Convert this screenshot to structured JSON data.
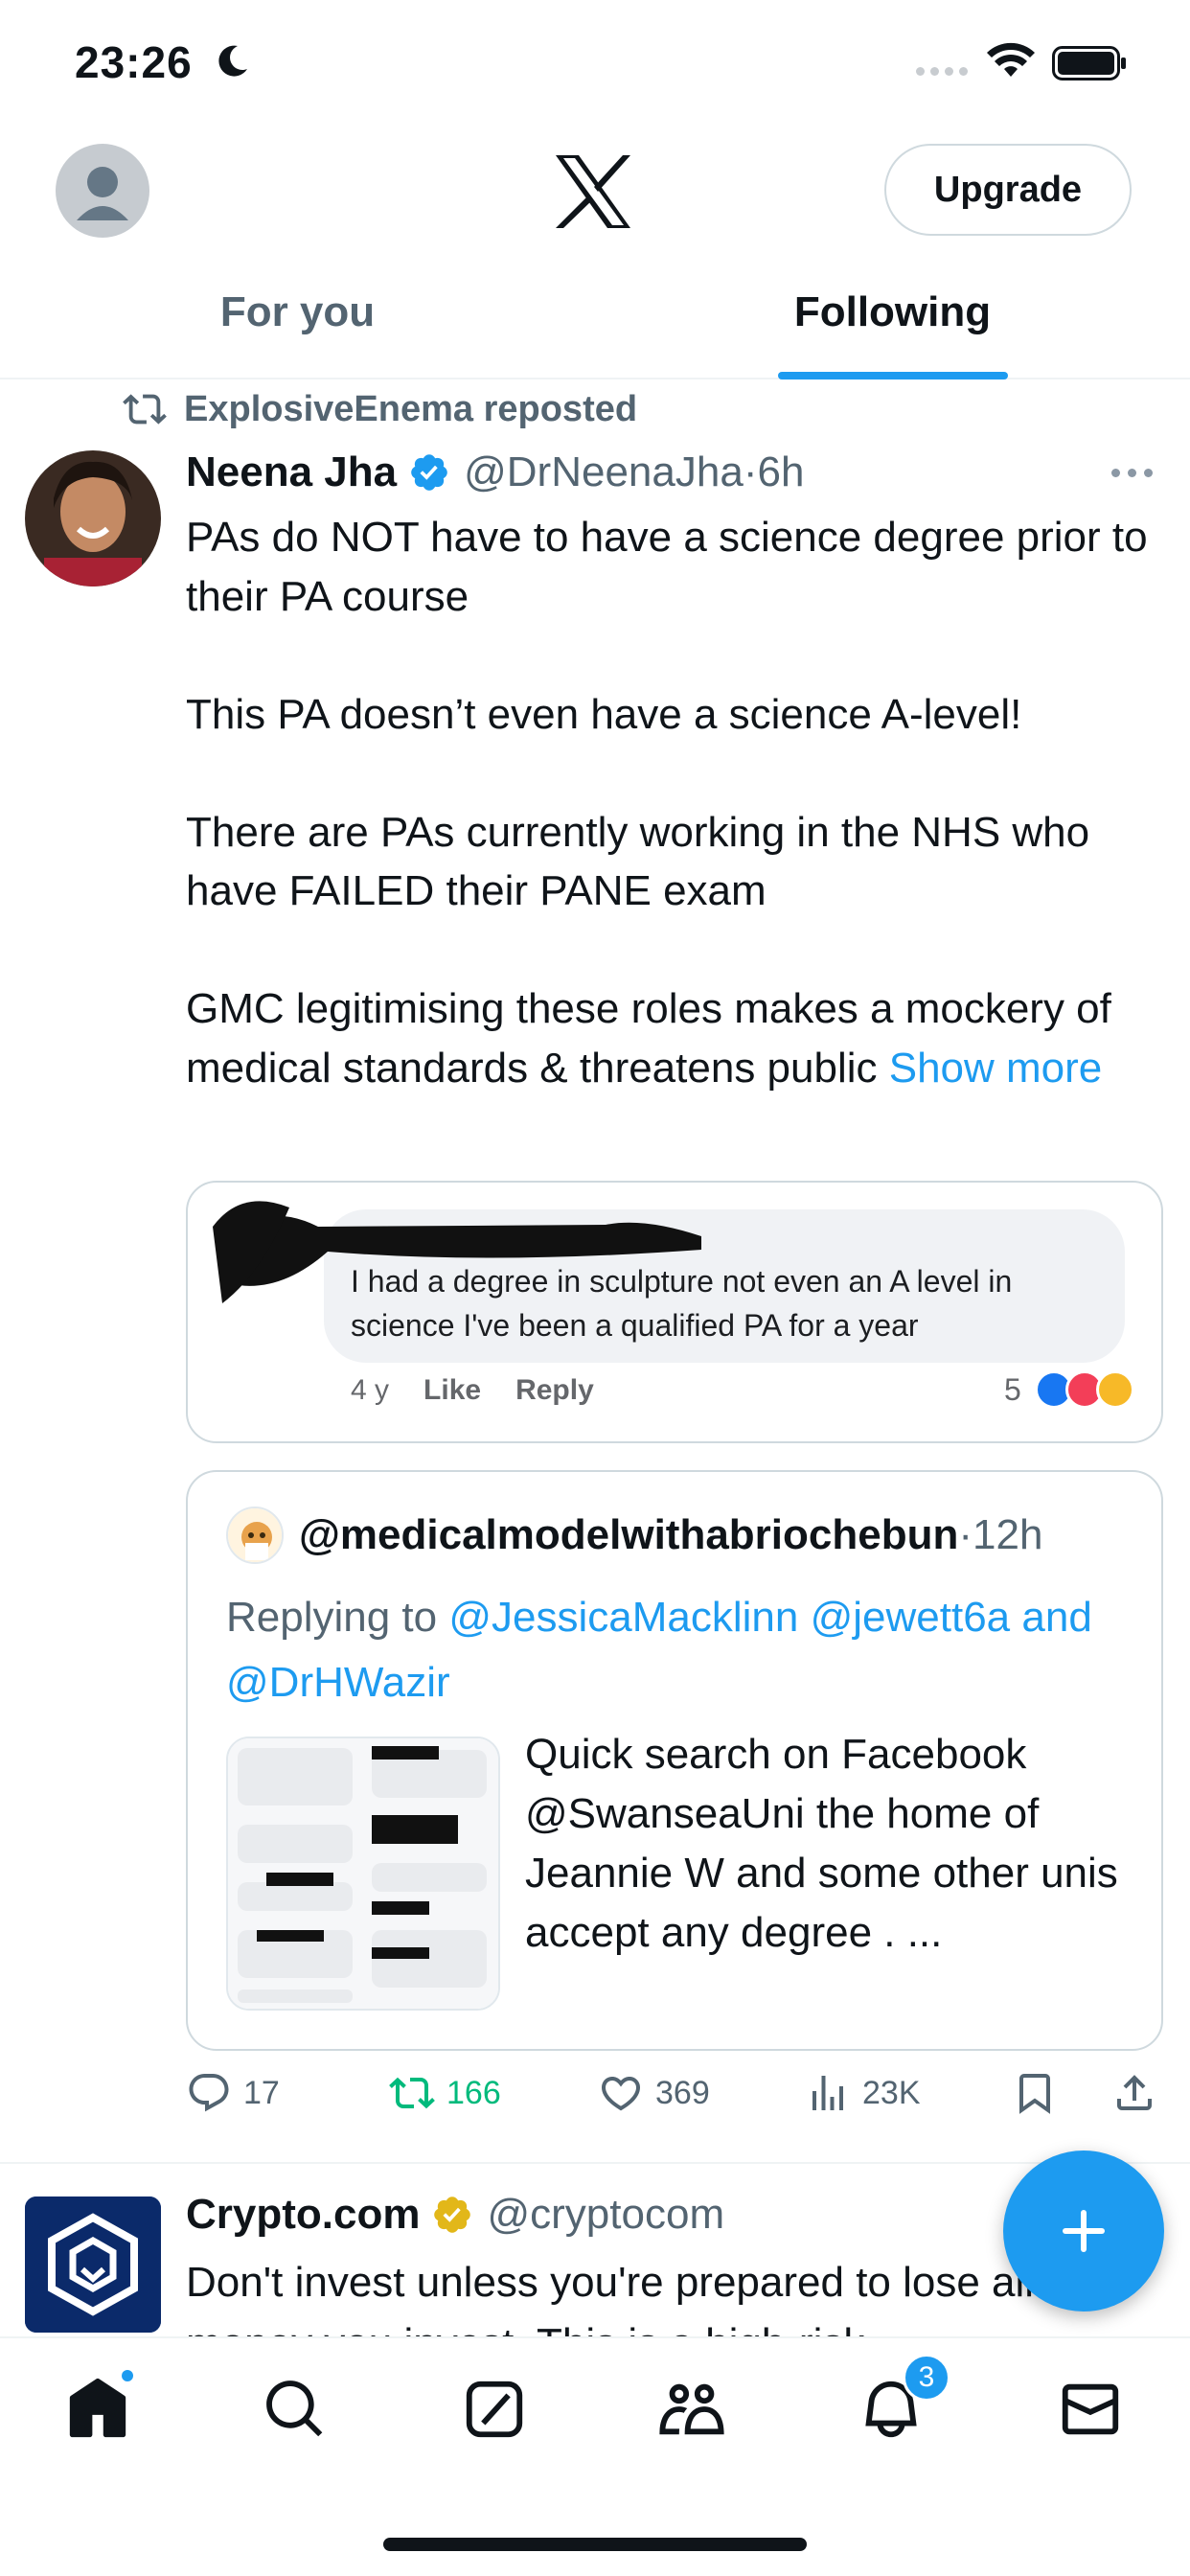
{
  "status_bar": {
    "time": "23:26"
  },
  "header": {
    "upgrade_label": "Upgrade"
  },
  "tabs": [
    {
      "label": "For you",
      "active": false
    },
    {
      "label": "Following",
      "active": true
    }
  ],
  "tweet": {
    "repost_text": "ExplosiveEnema reposted",
    "author_name": "Neena Jha",
    "author_handle": "@DrNeenaJha",
    "time": "6h",
    "body_main": "PAs do NOT have to have a science degree prior to their PA course\n\nThis PA doesn’t even have a science A-level!\n\nThere are PAs currently working in the NHS who have FAILED their PANE exam\n\nGMC legitimising these roles makes a mockery of medical standards & threatens public ",
    "show_more": "Show more",
    "media": {
      "comment_text": "I had a degree in sculpture  not even an A level in science I've been a qualified PA for a year",
      "age": "4 y",
      "like_label": "Like",
      "reply_label": "Reply",
      "reaction_count": "5"
    },
    "quote": {
      "handle": "@medicalmodelwithabriochebun",
      "time": "12h",
      "replying_prefix": "Replying to ",
      "reply_user1": "@JessicaMacklinn",
      "reply_user2": "@jewett6a",
      "reply_and": "and ",
      "reply_user3": "@DrHWazir",
      "text": "Quick search on Facebook @SwanseaUni the home of Jeannie W and some other unis  accept any degree . ..."
    },
    "actions": {
      "replies": "17",
      "reposts": "166",
      "likes": "369",
      "views": "23K"
    }
  },
  "ad": {
    "name": "Crypto.com",
    "handle": "@cryptocom",
    "body": "Don't invest unless you're prepared to lose all the money you invest. This is a high-risk"
  },
  "bottom_nav": {
    "notifications_badge": "3",
    "items": [
      "home-icon",
      "search-icon",
      "grok-icon",
      "communities-icon",
      "notifications-icon",
      "messages-icon"
    ]
  },
  "colors": {
    "accent": "#1d9bf0",
    "retweet_green": "#00ba7c",
    "muted": "#536471",
    "verified_gold": "#e2b719"
  }
}
